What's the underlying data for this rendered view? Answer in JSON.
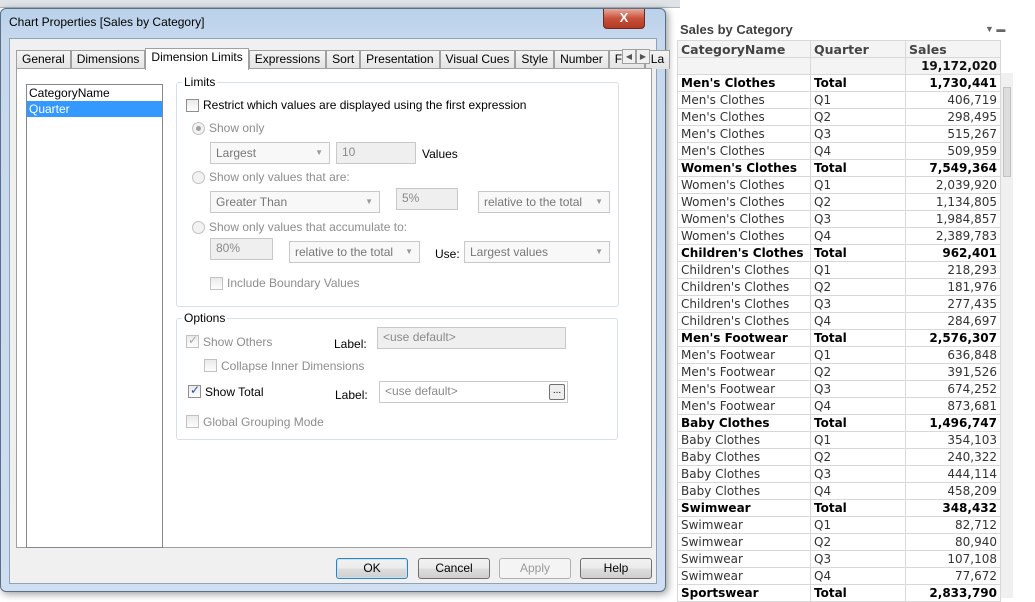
{
  "dialog": {
    "title": "Chart Properties [Sales by Category]",
    "close_label": "X",
    "tabs": [
      "General",
      "Dimensions",
      "Dimension Limits",
      "Expressions",
      "Sort",
      "Presentation",
      "Visual Cues",
      "Style",
      "Number",
      "Font",
      "La"
    ],
    "active_tab": "Dimension Limits",
    "dimensions": [
      "CategoryName",
      "Quarter"
    ],
    "selected_dimension": "Quarter",
    "limits": {
      "group_label": "Limits",
      "restrict_label": "Restrict which values are displayed using the first expression",
      "restrict_checked": false,
      "show_only_label": "Show only",
      "show_only_mode": "Largest",
      "show_only_count": "10",
      "values_label": "Values",
      "show_values_that_are_label": "Show only values that are:",
      "comparison": "Greater Than",
      "percent": "5%",
      "relative1": "relative to the total",
      "accumulate_label": "Show only values that accumulate to:",
      "accumulate_percent": "80%",
      "relative2": "relative to the total",
      "use_label": "Use:",
      "use_value": "Largest values",
      "include_boundary_label": "Include Boundary Values"
    },
    "options": {
      "group_label": "Options",
      "show_others_label": "Show Others",
      "show_others_checked": true,
      "label_text": "Label:",
      "others_placeholder": "<use default>",
      "collapse_label": "Collapse Inner Dimensions",
      "show_total_label": "Show Total",
      "show_total_checked": true,
      "total_placeholder": "<use default>",
      "ellipsis": "...",
      "global_grouping_label": "Global Grouping Mode"
    },
    "buttons": {
      "ok": "OK",
      "cancel": "Cancel",
      "apply": "Apply",
      "help": "Help"
    }
  },
  "sheet": {
    "title": "Sales by Category",
    "headers": [
      "CategoryName",
      "Quarter",
      "Sales"
    ],
    "grand_total": "19,172,020",
    "rows": [
      [
        "Men's Clothes",
        "Total",
        "1,730,441",
        true
      ],
      [
        "Men's Clothes",
        "Q1",
        "406,719",
        false
      ],
      [
        "Men's Clothes",
        "Q2",
        "298,495",
        false
      ],
      [
        "Men's Clothes",
        "Q3",
        "515,267",
        false
      ],
      [
        "Men's Clothes",
        "Q4",
        "509,959",
        false
      ],
      [
        "Women's Clothes",
        "Total",
        "7,549,364",
        true
      ],
      [
        "Women's Clothes",
        "Q1",
        "2,039,920",
        false
      ],
      [
        "Women's Clothes",
        "Q2",
        "1,134,805",
        false
      ],
      [
        "Women's Clothes",
        "Q3",
        "1,984,857",
        false
      ],
      [
        "Women's Clothes",
        "Q4",
        "2,389,783",
        false
      ],
      [
        "Children's Clothes",
        "Total",
        "962,401",
        true
      ],
      [
        "Children's Clothes",
        "Q1",
        "218,293",
        false
      ],
      [
        "Children's Clothes",
        "Q2",
        "181,976",
        false
      ],
      [
        "Children's Clothes",
        "Q3",
        "277,435",
        false
      ],
      [
        "Children's Clothes",
        "Q4",
        "284,697",
        false
      ],
      [
        "Men's Footwear",
        "Total",
        "2,576,307",
        true
      ],
      [
        "Men's Footwear",
        "Q1",
        "636,848",
        false
      ],
      [
        "Men's Footwear",
        "Q2",
        "391,526",
        false
      ],
      [
        "Men's Footwear",
        "Q3",
        "674,252",
        false
      ],
      [
        "Men's Footwear",
        "Q4",
        "873,681",
        false
      ],
      [
        "Baby Clothes",
        "Total",
        "1,496,747",
        true
      ],
      [
        "Baby Clothes",
        "Q1",
        "354,103",
        false
      ],
      [
        "Baby Clothes",
        "Q2",
        "240,322",
        false
      ],
      [
        "Baby Clothes",
        "Q3",
        "444,114",
        false
      ],
      [
        "Baby Clothes",
        "Q4",
        "458,209",
        false
      ],
      [
        "Swimwear",
        "Total",
        "348,432",
        true
      ],
      [
        "Swimwear",
        "Q1",
        "82,712",
        false
      ],
      [
        "Swimwear",
        "Q2",
        "80,940",
        false
      ],
      [
        "Swimwear",
        "Q3",
        "107,108",
        false
      ],
      [
        "Swimwear",
        "Q4",
        "77,672",
        false
      ],
      [
        "Sportswear",
        "Total",
        "2,833,790",
        true
      ]
    ]
  }
}
